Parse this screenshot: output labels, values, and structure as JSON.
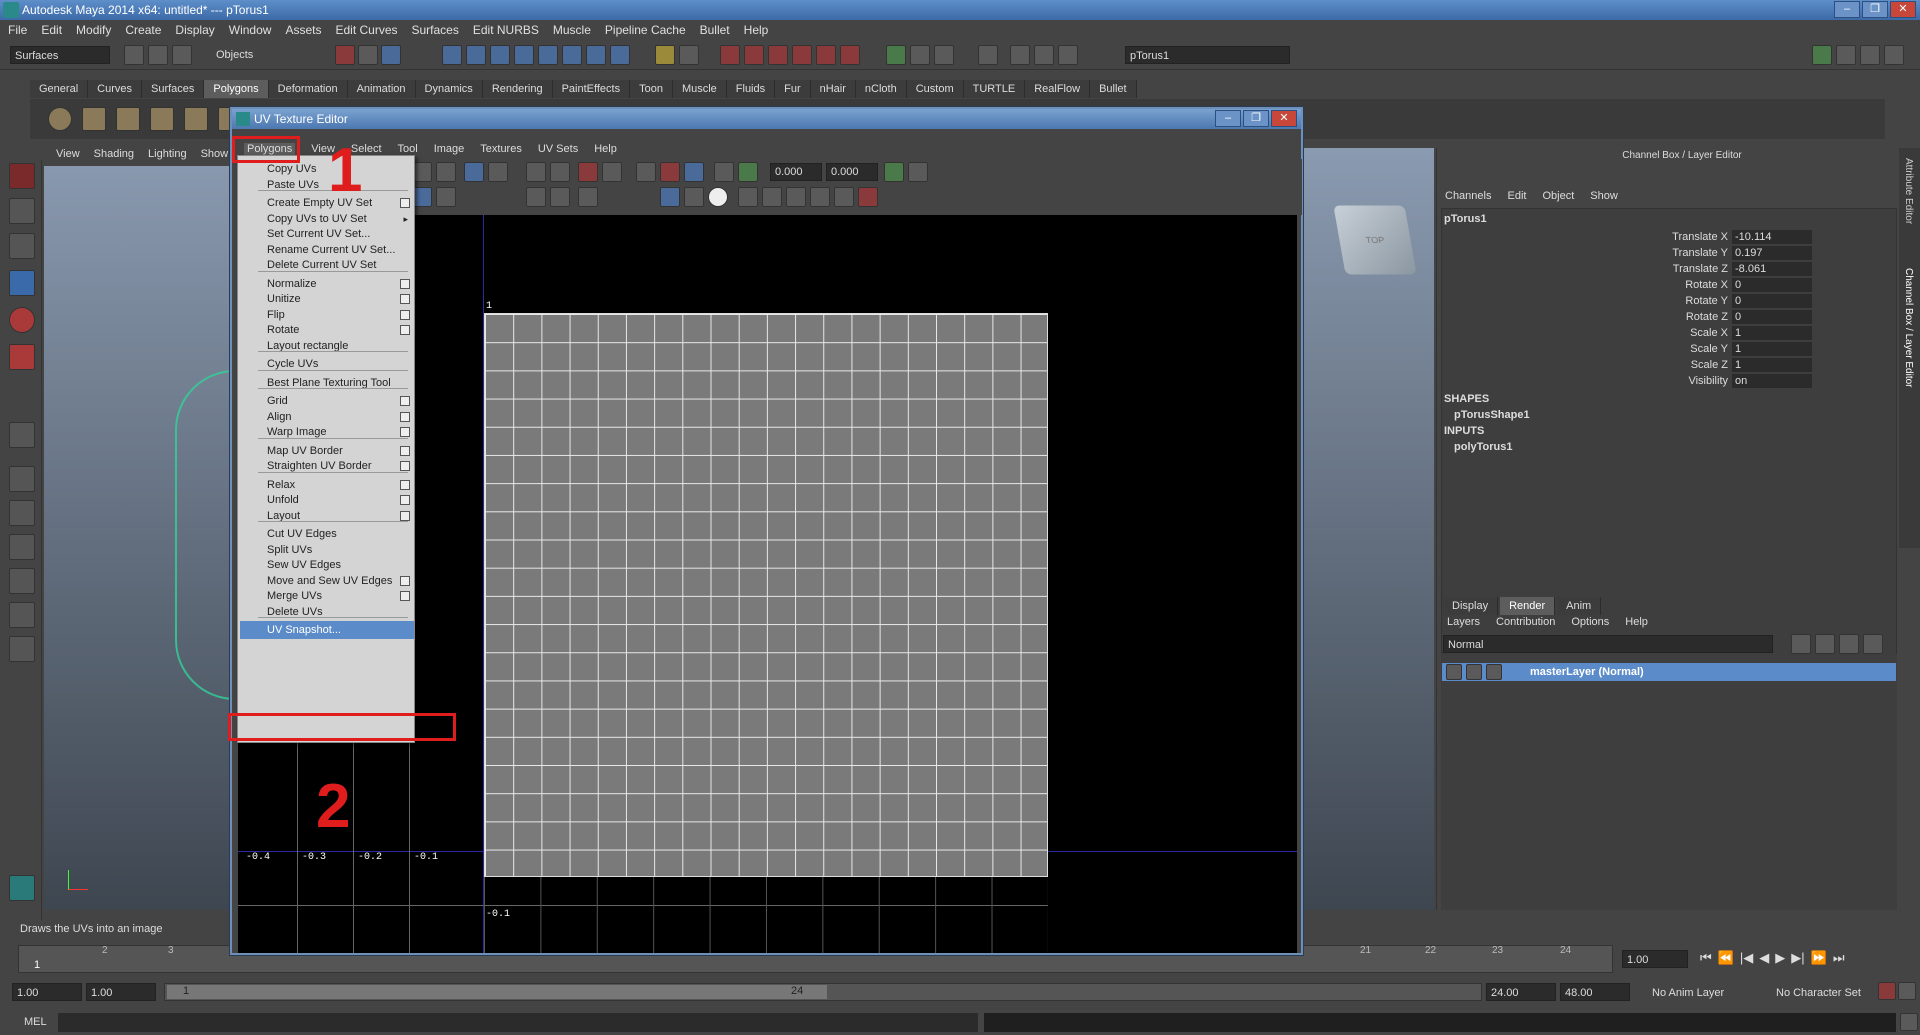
{
  "app": {
    "title": "Autodesk Maya 2014 x64: untitled*   ---   pTorus1",
    "menus": [
      "File",
      "Edit",
      "Modify",
      "Create",
      "Display",
      "Window",
      "Assets",
      "Edit Curves",
      "Surfaces",
      "Edit NURBS",
      "Muscle",
      "Pipeline Cache",
      "Bullet",
      "Help"
    ],
    "module_select": "Surfaces",
    "selection_mode": "Objects",
    "object_name_field": "pTorus1"
  },
  "shelf": {
    "tabs": [
      "General",
      "Curves",
      "Surfaces",
      "Polygons",
      "Deformation",
      "Animation",
      "Dynamics",
      "Rendering",
      "PaintEffects",
      "Toon",
      "Muscle",
      "Fluids",
      "Fur",
      "nHair",
      "nCloth",
      "Custom",
      "TURTLE",
      "RealFlow",
      "Bullet"
    ],
    "active_tab": "Polygons"
  },
  "viewport": {
    "menus": [
      "View",
      "Shading",
      "Lighting",
      "Show"
    ],
    "viewcube_label": "TOP"
  },
  "uv_editor": {
    "title": "UV Texture Editor",
    "menus": [
      "Polygons",
      "View",
      "Select",
      "Tool",
      "Image",
      "Textures",
      "UV Sets",
      "Help"
    ],
    "active_menu": "Polygons",
    "u_field": "0.000",
    "v_field": "0.000",
    "axis_labels_u": [
      "-0.4",
      "-0.3",
      "-0.2",
      "-0.1"
    ],
    "axis_label_v_neg": "-0.1",
    "axis_label_top": "1"
  },
  "polygons_menu": {
    "items": [
      {
        "label": "Copy UVs",
        "opt": false
      },
      {
        "label": "Paste UVs",
        "opt": false
      },
      {
        "sep": true
      },
      {
        "label": "Create Empty UV Set",
        "opt": true
      },
      {
        "label": "Copy UVs to UV Set",
        "sub": true
      },
      {
        "label": "Set Current UV Set...",
        "opt": false
      },
      {
        "label": "Rename Current UV Set...",
        "opt": false
      },
      {
        "label": "Delete Current UV Set",
        "opt": false
      },
      {
        "sep": true
      },
      {
        "label": "Normalize",
        "opt": true
      },
      {
        "label": "Unitize",
        "opt": true
      },
      {
        "label": "Flip",
        "opt": true
      },
      {
        "label": "Rotate",
        "opt": true
      },
      {
        "label": "Layout rectangle",
        "opt": false
      },
      {
        "sep": true
      },
      {
        "label": "Cycle UVs",
        "opt": false
      },
      {
        "sep": true
      },
      {
        "label": "Best Plane Texturing Tool",
        "opt": false
      },
      {
        "sep": true
      },
      {
        "label": "Grid",
        "opt": true
      },
      {
        "label": "Align",
        "opt": true
      },
      {
        "label": "Warp Image",
        "opt": true
      },
      {
        "sep": true
      },
      {
        "label": "Map UV Border",
        "opt": true
      },
      {
        "label": "Straighten UV Border",
        "opt": true
      },
      {
        "sep": true
      },
      {
        "label": "Relax",
        "opt": true
      },
      {
        "label": "Unfold",
        "opt": true
      },
      {
        "label": "Layout",
        "opt": true
      },
      {
        "sep": true
      },
      {
        "label": "Cut UV Edges",
        "opt": false
      },
      {
        "label": "Split UVs",
        "opt": false
      },
      {
        "label": "Sew UV Edges",
        "opt": false
      },
      {
        "label": "Move and Sew UV Edges",
        "opt": true
      },
      {
        "label": "Merge UVs",
        "opt": true
      },
      {
        "label": "Delete UVs",
        "opt": false
      },
      {
        "sep": true
      },
      {
        "label": "UV Snapshot...",
        "opt": false,
        "highlight": true
      }
    ]
  },
  "annotations": {
    "step1": "1",
    "step2": "2"
  },
  "channel_box": {
    "title": "Channel Box / Layer Editor",
    "menus": [
      "Channels",
      "Edit",
      "Object",
      "Show"
    ],
    "object": "pTorus1",
    "channels": [
      {
        "name": "Translate X",
        "value": "-10.114"
      },
      {
        "name": "Translate Y",
        "value": "0.197"
      },
      {
        "name": "Translate Z",
        "value": "-8.061"
      },
      {
        "name": "Rotate X",
        "value": "0"
      },
      {
        "name": "Rotate Y",
        "value": "0"
      },
      {
        "name": "Rotate Z",
        "value": "0"
      },
      {
        "name": "Scale X",
        "value": "1"
      },
      {
        "name": "Scale Y",
        "value": "1"
      },
      {
        "name": "Scale Z",
        "value": "1"
      },
      {
        "name": "Visibility",
        "value": "on"
      }
    ],
    "shapes_header": "SHAPES",
    "shape": "pTorusShape1",
    "inputs_header": "INPUTS",
    "input": "polyTorus1",
    "side_tabs": [
      "Attribute Editor",
      "Channel Box / Layer Editor"
    ]
  },
  "layer_editor": {
    "tabs": [
      "Display",
      "Render",
      "Anim"
    ],
    "active_tab": "Render",
    "menus": [
      "Layers",
      "Contribution",
      "Options",
      "Help"
    ],
    "blend_mode": "Normal",
    "layer": "masterLayer (Normal)"
  },
  "help_line": "Draws the UVs into an image",
  "time_slider": {
    "ticks": [
      "1",
      "2",
      "3",
      "21",
      "22",
      "23",
      "24"
    ],
    "current_frame": "1.00",
    "current_marker": "1"
  },
  "range_slider": {
    "start": "1.00",
    "start_inner": "1.00",
    "range_start_label": "1",
    "range_end_label": "24",
    "end_inner": "24.00",
    "end": "48.00",
    "anim_layer": "No Anim Layer",
    "character_set": "No Character Set"
  },
  "command_line": {
    "label": "MEL"
  }
}
